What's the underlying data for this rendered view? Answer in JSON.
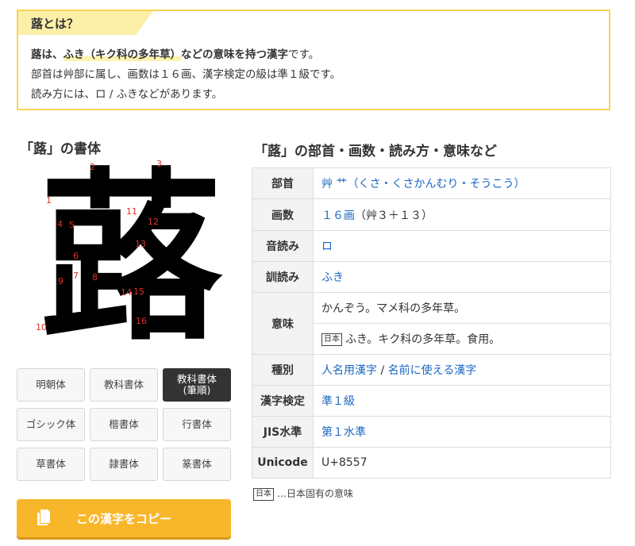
{
  "summary": {
    "title": "蕗とは？",
    "line1_bold1": "蕗は、",
    "line1_highlight": "ふき（キク科の多年草）",
    "line1_bold2": "などの意味を持つ漢字",
    "line1_tail": "です。",
    "line2": "部首は艸部に属し、画数は１６画、漢字検定の級は準１級です。",
    "line3": "読み方には、ロ / ふきなどがあります。"
  },
  "glyph_section": {
    "title": "「蕗」の書体",
    "character": "蕗",
    "stroke_numbers": [
      "1",
      "2",
      "3",
      "4",
      "5",
      "6",
      "7",
      "8",
      "9",
      "10",
      "11",
      "12",
      "13",
      "14",
      "15",
      "16"
    ]
  },
  "font_buttons": [
    {
      "label": "明朝体"
    },
    {
      "label": "教科書体"
    },
    {
      "label": "教科書体\n(筆順)",
      "active": true
    },
    {
      "label": "ゴシック体"
    },
    {
      "label": "楷書体"
    },
    {
      "label": "行書体"
    },
    {
      "label": "草書体"
    },
    {
      "label": "隷書体"
    },
    {
      "label": "篆書体"
    }
  ],
  "copy_button": {
    "label": "この漢字をコピー"
  },
  "info_section": {
    "title": "「蕗」の部首・画数・読み方・意味など",
    "rows": {
      "bushu": {
        "header": "部首",
        "value": "艸 艹（くさ・くさかんむり・そうこう）"
      },
      "kakusu": {
        "header": "画数",
        "value_link": "１６画",
        "value_note": "（艸３＋１３）"
      },
      "onyomi": {
        "header": "音読み",
        "value": "ロ"
      },
      "kunyomi": {
        "header": "訓読み",
        "value": "ふき"
      },
      "imi": {
        "header": "意味",
        "value1": "かんぞう。マメ科の多年草。",
        "tag": "日本",
        "value2": "ふき。キク科の多年草。食用。"
      },
      "shubetsu": {
        "header": "種別",
        "value_link1": "人名用漢字",
        "sep": "/",
        "value_link2": "名前に使える漢字"
      },
      "kentei": {
        "header": "漢字検定",
        "value": "準１級"
      },
      "jis": {
        "header": "JIS水準",
        "value": "第１水準"
      },
      "unicode": {
        "header": "Unicode",
        "value": "U+8557"
      }
    }
  },
  "footnote": {
    "tag": "日本",
    "text": "…日本固有の意味"
  },
  "colors": {
    "accent": "#f8b62b",
    "border": "#f7d354",
    "link": "#1a67c4",
    "stroke_num": "#e0302a"
  }
}
